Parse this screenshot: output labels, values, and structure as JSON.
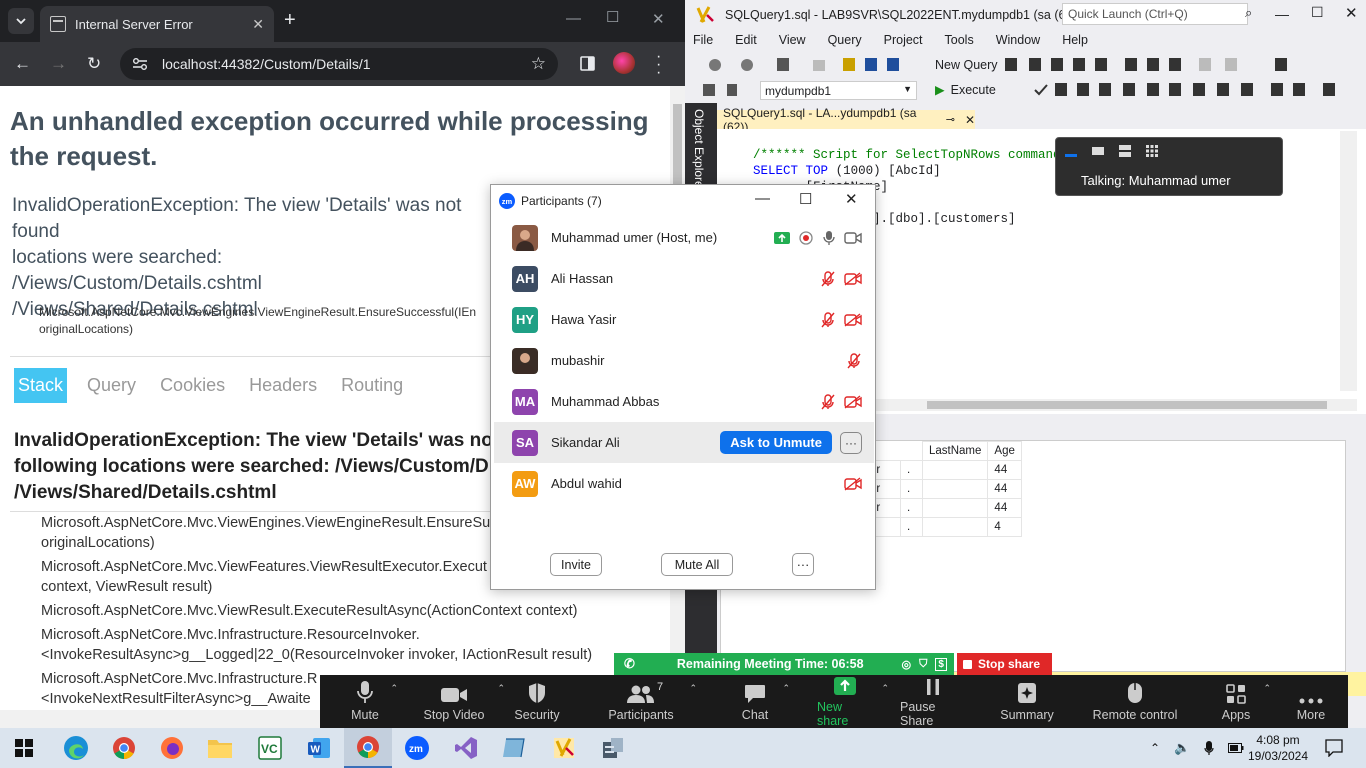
{
  "chrome": {
    "tab_title": "Internal Server Error",
    "url": "localhost:44382/Custom/Details/1",
    "error_heading": "An unhandled exception occurred while processing the request.",
    "exception_lines": [
      "InvalidOperationException: The view 'Details' was not found",
      "locations were searched:",
      "/Views/Custom/Details.cshtml",
      "/Views/Shared/Details.cshtml"
    ],
    "exception_source": "Microsoft.AspNetCore.Mvc.ViewEngines.ViewEngineResult.EnsureSuccessful(IEn",
    "exception_source2": "originalLocations)",
    "tabs": [
      "Stack",
      "Query",
      "Cookies",
      "Headers",
      "Routing"
    ],
    "stack_heading_lines": [
      "InvalidOperationException: The view 'Details' was no",
      "following locations were searched: /Views/Custom/D",
      "/Views/Shared/Details.cshtml"
    ],
    "frames": [
      [
        "Microsoft.AspNetCore.Mvc.ViewEngines.ViewEngineResult.EnsureSu",
        "originalLocations)"
      ],
      [
        "Microsoft.AspNetCore.Mvc.ViewFeatures.ViewResultExecutor.Execut",
        "context, ViewResult result)"
      ],
      [
        "Microsoft.AspNetCore.Mvc.ViewResult.ExecuteResultAsync(ActionContext context)"
      ],
      [
        "Microsoft.AspNetCore.Mvc.Infrastructure.ResourceInvoker.",
        "<InvokeResultAsync>g__Logged|22_0(ResourceInvoker invoker, IActionResult result)"
      ],
      [
        "Microsoft.AspNetCore.Mvc.Infrastructure.R",
        "<InvokeNextResultFilterAsync>g__Awaite"
      ]
    ]
  },
  "ssms": {
    "title": "SQLQuery1.sql - LAB9SVR\\SQL2022ENT.mydumpdb1 (sa (62))...",
    "quick_launch": "Quick Launch (Ctrl+Q)",
    "menu": [
      "File",
      "Edit",
      "View",
      "Query",
      "Project",
      "Tools",
      "Window",
      "Help"
    ],
    "new_query": "New Query",
    "database": "mydumpdb1",
    "execute": "Execute",
    "object_explorer": "Object Explorer",
    "doc_tab": "SQLQuery1.sql - LA...ydumpdb1 (sa (62))",
    "code_comment": "/****** Script for SelectTopNRows command from SSMS  ******/",
    "code_select": "SELECT",
    "code_top": "TOP",
    "code_top_rest": "(1000) [AbcId]",
    "code_line2": ",[FirstName]",
    "code_line_from": "].[dbo].[customers]",
    "grid_headers": [
      "LastName",
      "Age"
    ],
    "grid_rows": [
      [
        "er",
        ".",
        "44"
      ],
      [
        "er",
        ".",
        "44"
      ],
      [
        "er",
        ".",
        "44"
      ],
      [
        "",
        ".",
        "4"
      ]
    ]
  },
  "talking": {
    "text": "Talking: Muhammad umer"
  },
  "participants": {
    "title": "Participants (7)",
    "list": [
      {
        "name": "Muhammad umer (Host, me)",
        "initials": "",
        "color": "#8a5a44"
      },
      {
        "name": "Ali Hassan",
        "initials": "AH",
        "color": "#3c4c63"
      },
      {
        "name": "Hawa Yasir",
        "initials": "HY",
        "color": "#1fa085"
      },
      {
        "name": "mubashir",
        "initials": "",
        "color": "#3a2d26"
      },
      {
        "name": "Muhammad Abbas",
        "initials": "MA",
        "color": "#8e44ad"
      },
      {
        "name": "Sikandar Ali",
        "initials": "SA",
        "color": "#8e44ad"
      },
      {
        "name": "Abdul wahid",
        "initials": "AW",
        "color": "#f39c12"
      }
    ],
    "ask_unmute": "Ask to Unmute",
    "invite": "Invite",
    "mute_all": "Mute All"
  },
  "meeting": {
    "remaining": "Remaining Meeting Time: 06:58",
    "stop_share": "Stop share",
    "participant_count": "7",
    "buttons": [
      "Mute",
      "Stop Video",
      "Security",
      "Participants",
      "Chat",
      "New share",
      "Pause Share",
      "Summary",
      "Remote control",
      "Apps",
      "More"
    ]
  },
  "taskbar": {
    "time": "4:08 pm",
    "date": "19/03/2024"
  },
  "colors": {
    "accent": "#44c5f2",
    "zoom_blue": "#0e71eb",
    "share_green": "#22ae52",
    "stop_red": "#e02828"
  }
}
